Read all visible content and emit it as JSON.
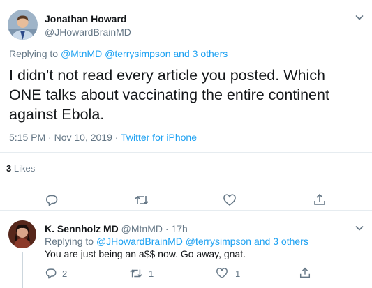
{
  "main_tweet": {
    "author_name": "Jonathan Howard",
    "author_handle": "@JHowardBrainMD",
    "replying_prefix": "Replying to ",
    "replying_mention1": "@MtnMD",
    "replying_mention2": "@terrysimpson",
    "replying_and": " and ",
    "replying_others": "3 others",
    "text": "I didn’t not read every article you posted.  Which ONE talks about vaccinating the entire continent against Ebola.",
    "time": "5:15 PM · Nov 10, 2019 · ",
    "source": "Twitter for iPhone",
    "likes_count": "3",
    "likes_label": " Likes",
    "actions": {
      "reply_icon": "reply-icon",
      "retweet_icon": "retweet-icon",
      "like_icon": "heart-icon",
      "share_icon": "share-icon"
    }
  },
  "reply_tweet": {
    "author_name": "K. Sennholz MD",
    "author_handle": "@MtnMD",
    "separator": " · ",
    "time": "17h",
    "replying_prefix": "Replying to ",
    "replying_mention1": "@JHowardBrainMD",
    "replying_mention2": "@terrysimpson",
    "replying_and": " and ",
    "replying_others": "3 others",
    "text": "You are just being an a$$ now. Go away, gnat.",
    "reply_count": "2",
    "retweet_count": "1",
    "like_count": "1"
  },
  "colors": {
    "accent": "#1da1f2",
    "secondary_text": "#657786",
    "primary_text": "#14171a",
    "border": "#e6ecf0"
  }
}
